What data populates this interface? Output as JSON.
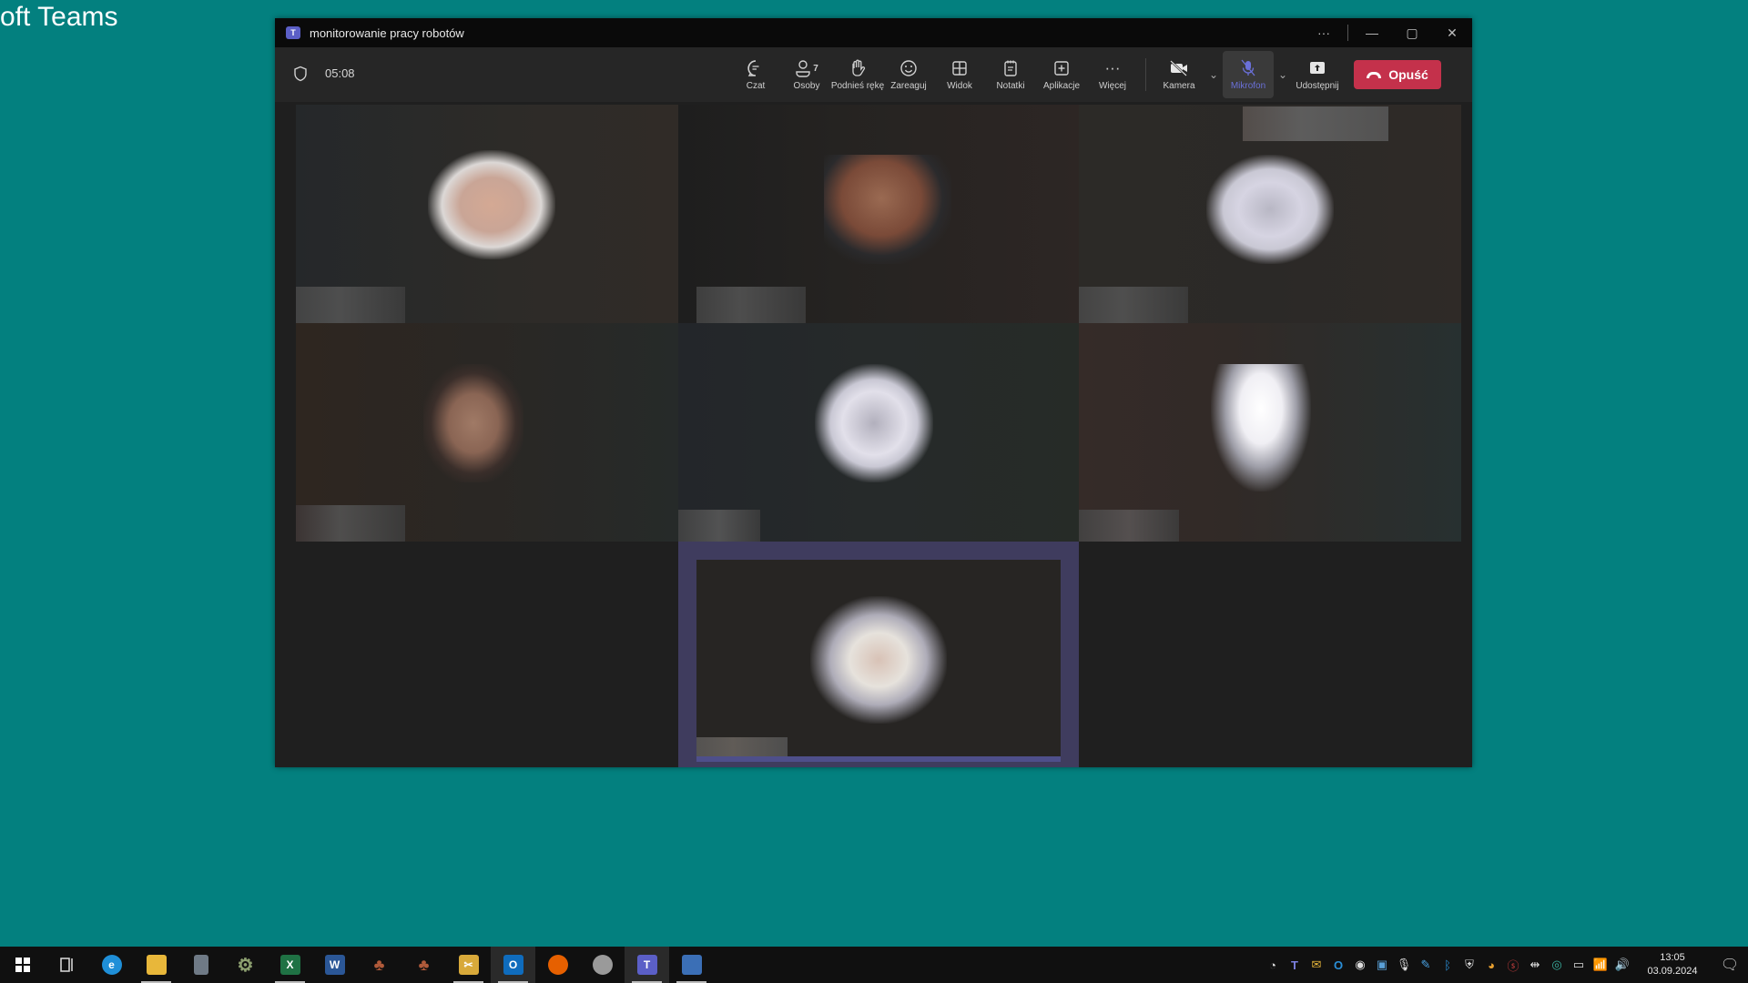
{
  "background_window_title_fragment": "oft Teams",
  "window": {
    "title": "monitorowanie pracy robotów",
    "controls": {
      "more": "···",
      "minimize": "—",
      "maximize": "▢",
      "close": "✕"
    }
  },
  "toolbar": {
    "timer": "05:08",
    "items": [
      {
        "key": "chat",
        "label": "Czat",
        "icon": "chat-icon",
        "glyph": "💬"
      },
      {
        "key": "people",
        "label": "Osoby",
        "icon": "people-icon",
        "glyph": "👤",
        "count": "7"
      },
      {
        "key": "raise-hand",
        "label": "Podnieś rękę",
        "icon": "hand-icon",
        "glyph": "✋"
      },
      {
        "key": "react",
        "label": "Zareaguj",
        "icon": "smiley-icon",
        "glyph": "☺"
      },
      {
        "key": "view",
        "label": "Widok",
        "icon": "grid-icon",
        "glyph": "⊞"
      },
      {
        "key": "notes",
        "label": "Notatki",
        "icon": "notes-icon",
        "glyph": "📝"
      },
      {
        "key": "apps",
        "label": "Aplikacje",
        "icon": "add-app-icon",
        "glyph": "⊞"
      },
      {
        "key": "more",
        "label": "Więcej",
        "icon": "more-icon",
        "glyph": "···"
      }
    ],
    "camera": {
      "label": "Kamera",
      "state": "off",
      "glyph": "📷"
    },
    "microphone": {
      "label": "Mikrofon",
      "state": "muted",
      "glyph": "🎤"
    },
    "share": {
      "label": "Udostępnij",
      "glyph": "⬆"
    },
    "leave": {
      "label": "Opuść",
      "color": "#c4314b"
    }
  },
  "participants": {
    "count": 7,
    "tiles": [
      {
        "row": 1,
        "col": 1,
        "name_blurred": true,
        "video": "pixelated"
      },
      {
        "row": 1,
        "col": 2,
        "name_blurred": true,
        "video": "pixelated"
      },
      {
        "row": 1,
        "col": 3,
        "name_blurred": true,
        "video": "pixelated"
      },
      {
        "row": 2,
        "col": 1,
        "name_blurred": true,
        "video": "pixelated"
      },
      {
        "row": 2,
        "col": 2,
        "name_blurred": true,
        "video": "pixelated"
      },
      {
        "row": 2,
        "col": 3,
        "name_blurred": true,
        "video": "pixelated"
      },
      {
        "row": 3,
        "col": 2,
        "name_blurred": true,
        "video": "pixelated",
        "active_speaker": true
      }
    ]
  },
  "colors": {
    "desktop": "#03807f",
    "teams_accent": "#5b5fc7",
    "speaker_border": "#3f3c5e",
    "leave": "#c4314b"
  },
  "taskbar": {
    "apps": [
      {
        "name": "start",
        "glyph": "⊞",
        "color": "#ffffff"
      },
      {
        "name": "task-view",
        "glyph": "⧉",
        "color": "#ffffff"
      },
      {
        "name": "edge",
        "glyph": "e",
        "color": "#1f8fd8"
      },
      {
        "name": "file-explorer",
        "glyph": "📁",
        "color": "#e8b73a",
        "active": true
      },
      {
        "name": "calculator",
        "glyph": "▦",
        "color": "#6f7a86"
      },
      {
        "name": "settings-app",
        "glyph": "⚙",
        "color": "#7e9a6a"
      },
      {
        "name": "excel",
        "glyph": "X",
        "color": "#1f7244",
        "active": true
      },
      {
        "name": "word",
        "glyph": "W",
        "color": "#2b5797"
      },
      {
        "name": "app-red-1",
        "glyph": "♣",
        "color": "#a0522d"
      },
      {
        "name": "app-red-2",
        "glyph": "♣",
        "color": "#a0522d"
      },
      {
        "name": "snipping-tool",
        "glyph": "✂",
        "color": "#d8a93a",
        "active": true
      },
      {
        "name": "outlook",
        "glyph": "O",
        "color": "#0f6cbd",
        "active": true,
        "selected": true
      },
      {
        "name": "firefox",
        "glyph": "🦊",
        "color": "#e66000"
      },
      {
        "name": "paint",
        "glyph": "🎨",
        "color": "#8d8d8d"
      },
      {
        "name": "teams",
        "glyph": "T",
        "color": "#5b5fc7",
        "active": true,
        "selected": true
      },
      {
        "name": "remote-desktop",
        "glyph": "🖥",
        "color": "#3b6fb6",
        "active": true
      }
    ],
    "tray": [
      {
        "name": "tray-app-1",
        "glyph": "◔"
      },
      {
        "name": "tray-teams",
        "glyph": "T"
      },
      {
        "name": "tray-mail",
        "glyph": "✉"
      },
      {
        "name": "tray-outlook",
        "glyph": "O"
      },
      {
        "name": "tray-app-2",
        "glyph": "◉"
      },
      {
        "name": "tray-app-3",
        "glyph": "▣"
      },
      {
        "name": "tray-microphone",
        "glyph": "🎙"
      },
      {
        "name": "tray-pen",
        "glyph": "✎"
      },
      {
        "name": "tray-bluetooth",
        "glyph": "ᛒ"
      },
      {
        "name": "tray-security",
        "glyph": "⛨"
      },
      {
        "name": "tray-app-4",
        "glyph": "◕"
      },
      {
        "name": "tray-app-5",
        "glyph": "ⓢ"
      },
      {
        "name": "tray-network-adapter",
        "glyph": "⇹"
      },
      {
        "name": "tray-app-6",
        "glyph": "◎"
      },
      {
        "name": "tray-battery",
        "glyph": "▭"
      },
      {
        "name": "tray-wifi",
        "glyph": "📶"
      },
      {
        "name": "tray-volume",
        "glyph": "🔊"
      }
    ],
    "time": "13:05",
    "date": "03.09.2024",
    "notifications_glyph": "🗨"
  }
}
